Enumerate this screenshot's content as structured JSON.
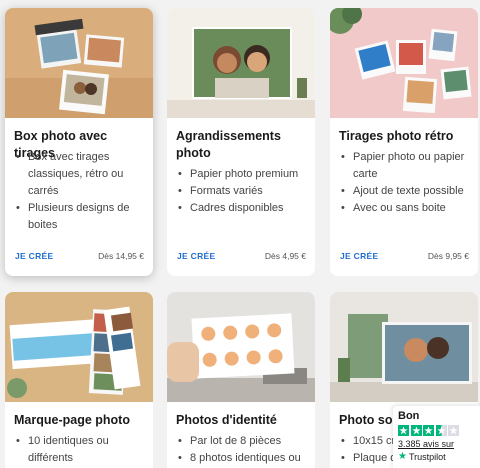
{
  "cards": [
    {
      "title": "Box photo avec tirages",
      "bullets": [
        "Box avec tirages classiques, rétro ou carrés",
        "Plusieurs designs de boites"
      ],
      "cta": "JE CRÉE",
      "price": "Dès 14,95 €"
    },
    {
      "title": "Agrandissements photo",
      "bullets": [
        "Papier photo premium",
        "Formats variés",
        "Cadres disponibles"
      ],
      "cta": "JE CRÉE",
      "price": "Dès 4,95 €"
    },
    {
      "title": "Tirages photo rétro",
      "bullets": [
        "Papier photo ou papier carte",
        "Ajout de texte possible",
        "Avec ou sans boite"
      ],
      "cta": "JE CRÉE",
      "price": "Dès 9,95 €"
    },
    {
      "title": "Marque-page photo",
      "bullets": [
        "10 identiques ou différents"
      ]
    },
    {
      "title": "Photos d'identité",
      "bullets": [
        "Par lot de 8 pièces",
        "8 photos identiques ou"
      ]
    },
    {
      "title": "Photo sou",
      "bullets": [
        "10x15 cr",
        "Plaque d"
      ]
    }
  ],
  "trustpilot": {
    "rating_label": "Bon",
    "stars": 3.5,
    "review_count": "3.385 avis sur",
    "brand": "Trustpilot",
    "color": "#00b67a"
  },
  "colors": {
    "accent": "#1f6fd1",
    "background": "#f2f2f2"
  }
}
